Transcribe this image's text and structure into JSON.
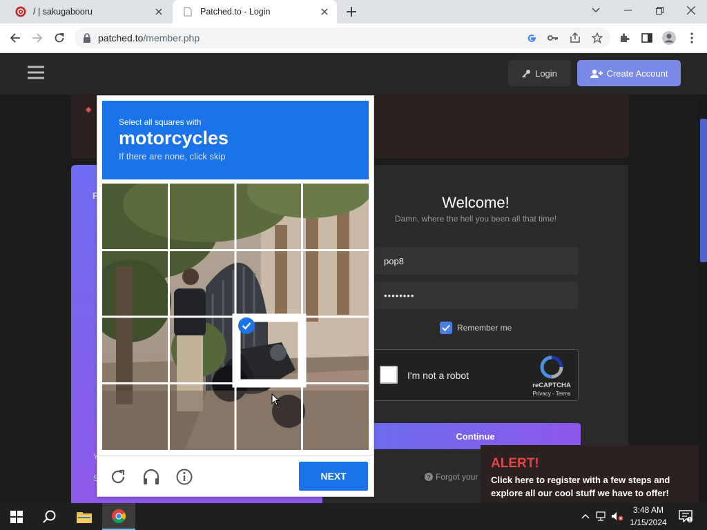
{
  "browser": {
    "tabs": [
      {
        "title": "/ | sakugabooru",
        "active": false
      },
      {
        "title": "Patched.to - Login",
        "active": true
      }
    ],
    "url": {
      "host": "patched.to",
      "path": "/member.php"
    }
  },
  "site": {
    "nav": {
      "login_label": "Login",
      "create_label": "Create Account"
    },
    "login": {
      "title": "Welcome!",
      "subtitle": "Damn, where the hell you been all that time!",
      "username_value": "pop8",
      "password_value": "••••••••",
      "remember_label": "Remember me",
      "remember_checked": true,
      "continue_label": "Continue",
      "forgot_label": "Forgot your"
    },
    "left_fragments": {
      "p": "P",
      "y": "Y",
      "s": "S"
    },
    "recaptcha": {
      "label": "I'm not a robot",
      "brand": "reCAPTCHA",
      "terms": "Privacy - Terms"
    },
    "alert": {
      "title": "ALERT!",
      "body": "Click here to register with a few steps and explore all our cool stuff we have to offer!"
    }
  },
  "challenge": {
    "instruction_small": "Select all squares with",
    "instruction_big": "motorcycles",
    "instruction_hint": "If there are none, click skip",
    "grid_rows": 4,
    "grid_cols": 4,
    "selected_tiles": [
      {
        "row": 2,
        "col": 2
      }
    ],
    "next_label": "NEXT",
    "icons": [
      "reload-icon",
      "audio-icon",
      "info-icon"
    ]
  },
  "taskbar": {
    "time": "3:48 AM",
    "date": "1/15/2024"
  },
  "colors": {
    "accent": "#1a73e8",
    "site_purple": "#7a88e6",
    "alert_red": "#e04848"
  }
}
